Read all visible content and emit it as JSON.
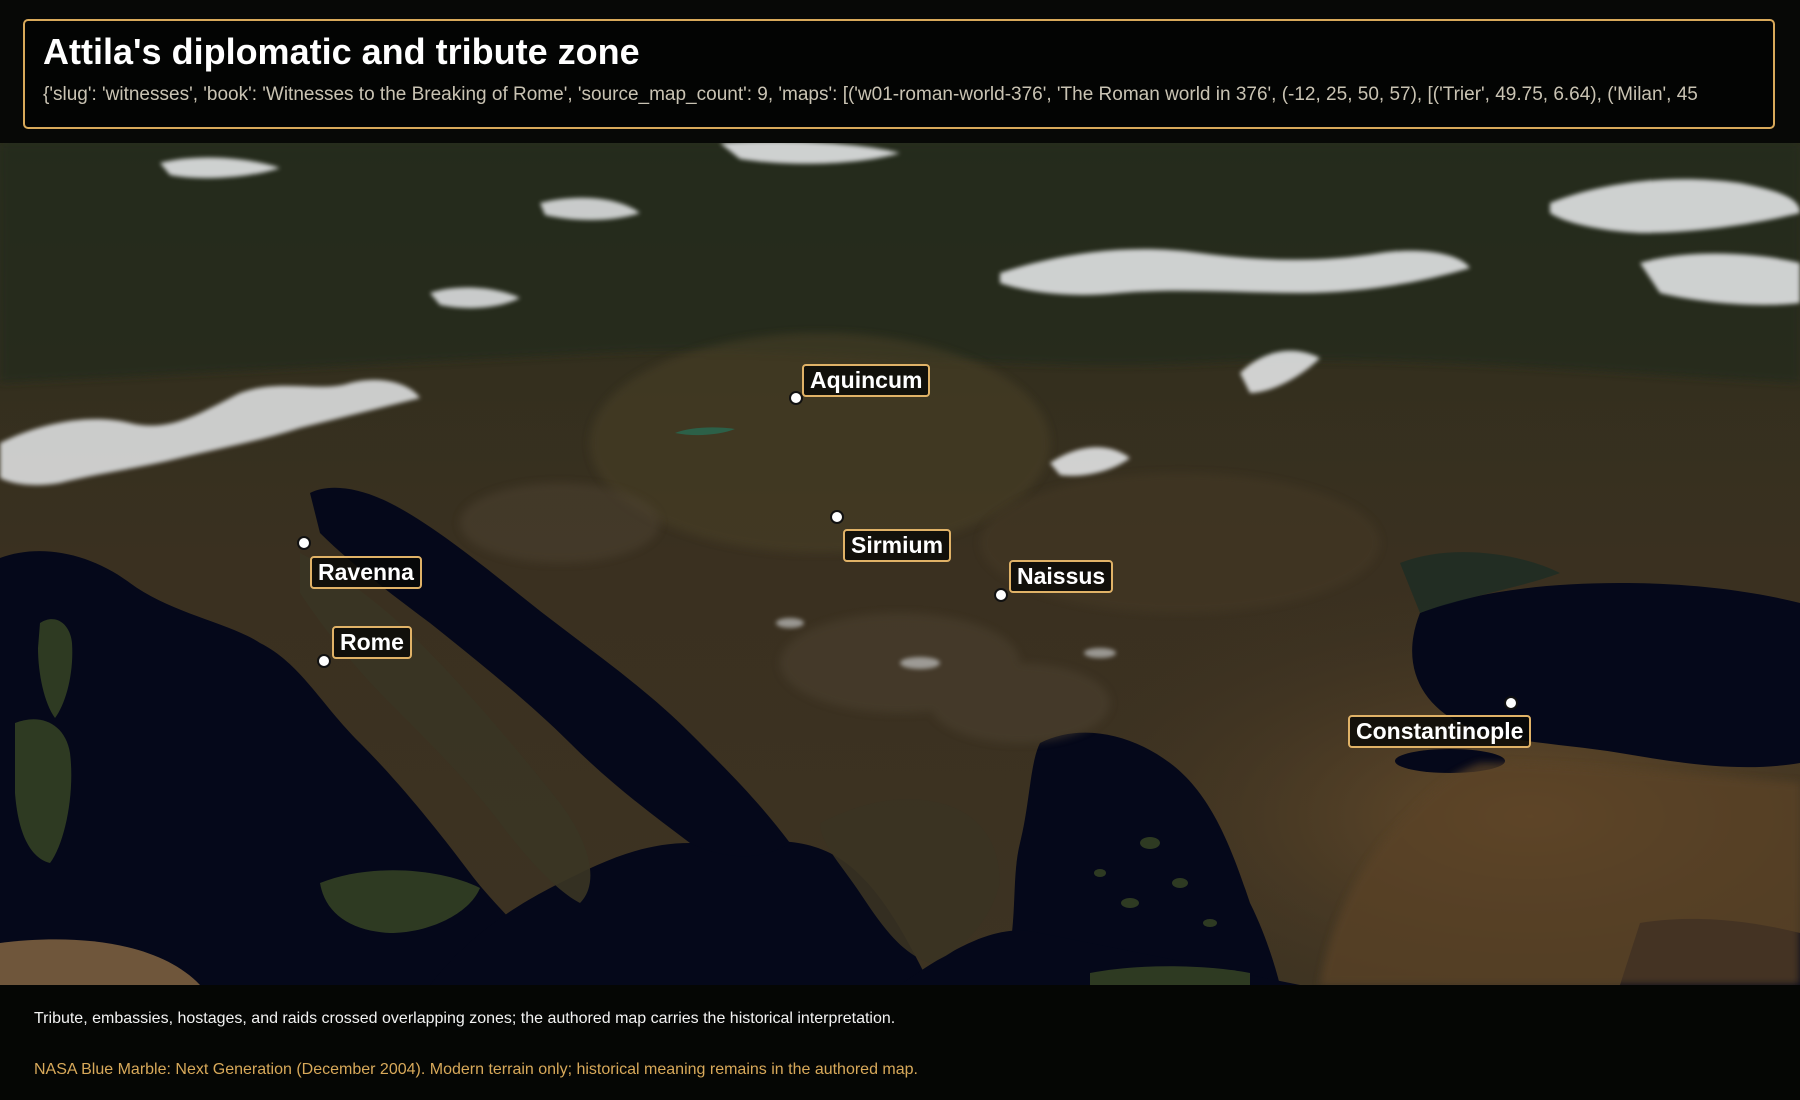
{
  "header": {
    "title": "Attila's diplomatic and tribute zone",
    "subtitle": "{'slug': 'witnesses', 'book': 'Witnesses to the Breaking of Rome', 'source_map_count': 9, 'maps': [('w01-roman-world-376', 'The Roman world in 376', (-12, 25, 50, 57), [('Trier', 49.75, 6.64), ('Milan', 45"
  },
  "map": {
    "basemap": "satellite-terrain",
    "colors": {
      "sea": "#05081a",
      "land": "#2e2c1c",
      "snow": "#e6e8ea",
      "label_border": "#e0b267",
      "header_border": "#d8a95a"
    },
    "places": [
      {
        "key": "aquincum",
        "name": "Aquincum"
      },
      {
        "key": "sirmium",
        "name": "Sirmium"
      },
      {
        "key": "naissus",
        "name": "Naissus"
      },
      {
        "key": "ravenna",
        "name": "Ravenna"
      },
      {
        "key": "rome",
        "name": "Rome"
      },
      {
        "key": "constantinople",
        "name": "Constantinople"
      }
    ]
  },
  "footer": {
    "caption": "Tribute, embassies, hostages, and raids crossed overlapping zones; the authored map carries the historical interpretation.",
    "credit": "NASA Blue Marble: Next Generation (December 2004). Modern terrain only; historical meaning remains in the authored map."
  }
}
